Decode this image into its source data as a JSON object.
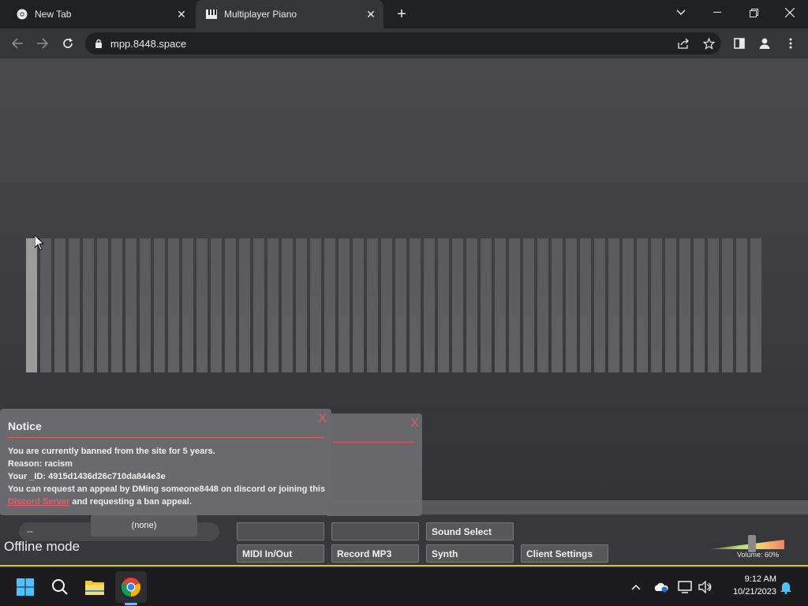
{
  "browser": {
    "tabs": [
      {
        "title": "New Tab",
        "active": false
      },
      {
        "title": "Multiplayer Piano",
        "active": true
      }
    ],
    "url": "mpp.8448.space"
  },
  "app": {
    "status": "Offline mode",
    "channel_value": "--",
    "channel_option": "(none)",
    "buttons": {
      "sound_select": "Sound Select",
      "midi": "MIDI In/Out",
      "record": "Record MP3",
      "synth": "Synth",
      "client_settings": "Client Settings"
    },
    "volume_label": "Volume: 60%",
    "volume_level": 0.6
  },
  "notice": {
    "title": "Notice",
    "close": "X",
    "line1": "You are currently banned from the site for 5 years.",
    "line2": "Reason: racism",
    "line3": "Your _ID: 4915d1436d26c710da844e3e",
    "line4_a": "You can request an appeal by DMing someone8448 on discord or joining this ",
    "link": "Discord Server",
    "line4_b": " and requesting a ban appeal."
  },
  "notice_back": {
    "close": "X"
  },
  "taskbar": {
    "time": "9:12 AM",
    "date": "10/21/2023"
  },
  "colors": {
    "accent_red": "#e06060",
    "link": "#e85a70",
    "taskbar_indicator": "#7bb4ff"
  }
}
